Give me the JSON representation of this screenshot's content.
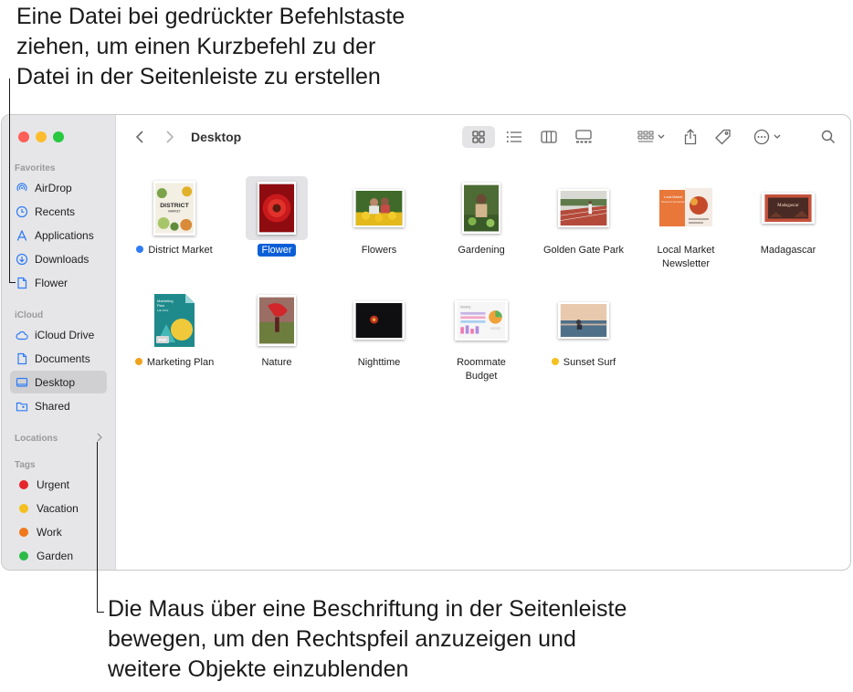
{
  "callouts": {
    "top_line1": "Eine Datei bei gedrückter Befehlstaste",
    "top_line2": "ziehen, um einen Kurzbefehl zu der",
    "top_line3": "Datei in der Seitenleiste zu erstellen",
    "bottom_line1": "Die Maus über eine Beschriftung in der Seitenleiste",
    "bottom_line2": "bewegen, um den Rechtspfeil anzuzeigen und",
    "bottom_line3": "weitere Objekte einzublenden"
  },
  "window": {
    "title": "Desktop"
  },
  "sidebar": {
    "favorites_title": "Favorites",
    "favorites": [
      {
        "label": "AirDrop",
        "icon": "airdrop-icon"
      },
      {
        "label": "Recents",
        "icon": "clock-icon"
      },
      {
        "label": "Applications",
        "icon": "applications-icon"
      },
      {
        "label": "Downloads",
        "icon": "download-icon"
      },
      {
        "label": "Flower",
        "icon": "document-icon"
      }
    ],
    "icloud_title": "iCloud",
    "icloud": [
      {
        "label": "iCloud Drive",
        "icon": "cloud-icon"
      },
      {
        "label": "Documents",
        "icon": "document-icon"
      },
      {
        "label": "Desktop",
        "icon": "desktop-icon"
      },
      {
        "label": "Shared",
        "icon": "shared-folder-icon"
      }
    ],
    "locations_title": "Locations",
    "tags_title": "Tags",
    "tags": [
      {
        "label": "Urgent",
        "color": "#e5262b"
      },
      {
        "label": "Vacation",
        "color": "#f4c01f"
      },
      {
        "label": "Work",
        "color": "#f0771c"
      },
      {
        "label": "Garden",
        "color": "#2dbb47"
      }
    ]
  },
  "colors": {
    "accent": "#0a5fd6",
    "sidebar_icon": "#2f7cf6",
    "close": "#fe5f57",
    "minimize": "#febc2e",
    "zoom": "#28c840"
  },
  "files": [
    {
      "name": "District Market",
      "tag_color": "#2f7cf6",
      "selected": false
    },
    {
      "name": "Flower",
      "tag_color": null,
      "selected": true
    },
    {
      "name": "Flowers",
      "tag_color": null,
      "selected": false
    },
    {
      "name": "Gardening",
      "tag_color": null,
      "selected": false
    },
    {
      "name": "Golden Gate Park",
      "tag_color": null,
      "selected": false
    },
    {
      "name": "Local Market Newsletter",
      "tag_color": null,
      "selected": false
    },
    {
      "name": "Madagascar",
      "tag_color": null,
      "selected": false
    },
    {
      "name": "Marketing Plan",
      "tag_color": "#f0a21c",
      "selected": false
    },
    {
      "name": "Nature",
      "tag_color": null,
      "selected": false
    },
    {
      "name": "Nighttime",
      "tag_color": null,
      "selected": false
    },
    {
      "name": "Roommate Budget",
      "tag_color": null,
      "selected": false
    },
    {
      "name": "Sunset Surf",
      "tag_color": "#f4c01f",
      "selected": false
    }
  ],
  "thumb_text": {
    "district_title": "DISTRICT",
    "district_sub": "MARKET",
    "marketing_title": "Marketing",
    "marketing_sub1": "Plan",
    "marketing_sub2": "Fall 2019",
    "pdf_badge": "PDF",
    "local_market_header": "Local Market",
    "local_market_sub": "Weekend Newsletter",
    "madagascar_title": "Madagascar",
    "budget_header": "Monthly"
  }
}
